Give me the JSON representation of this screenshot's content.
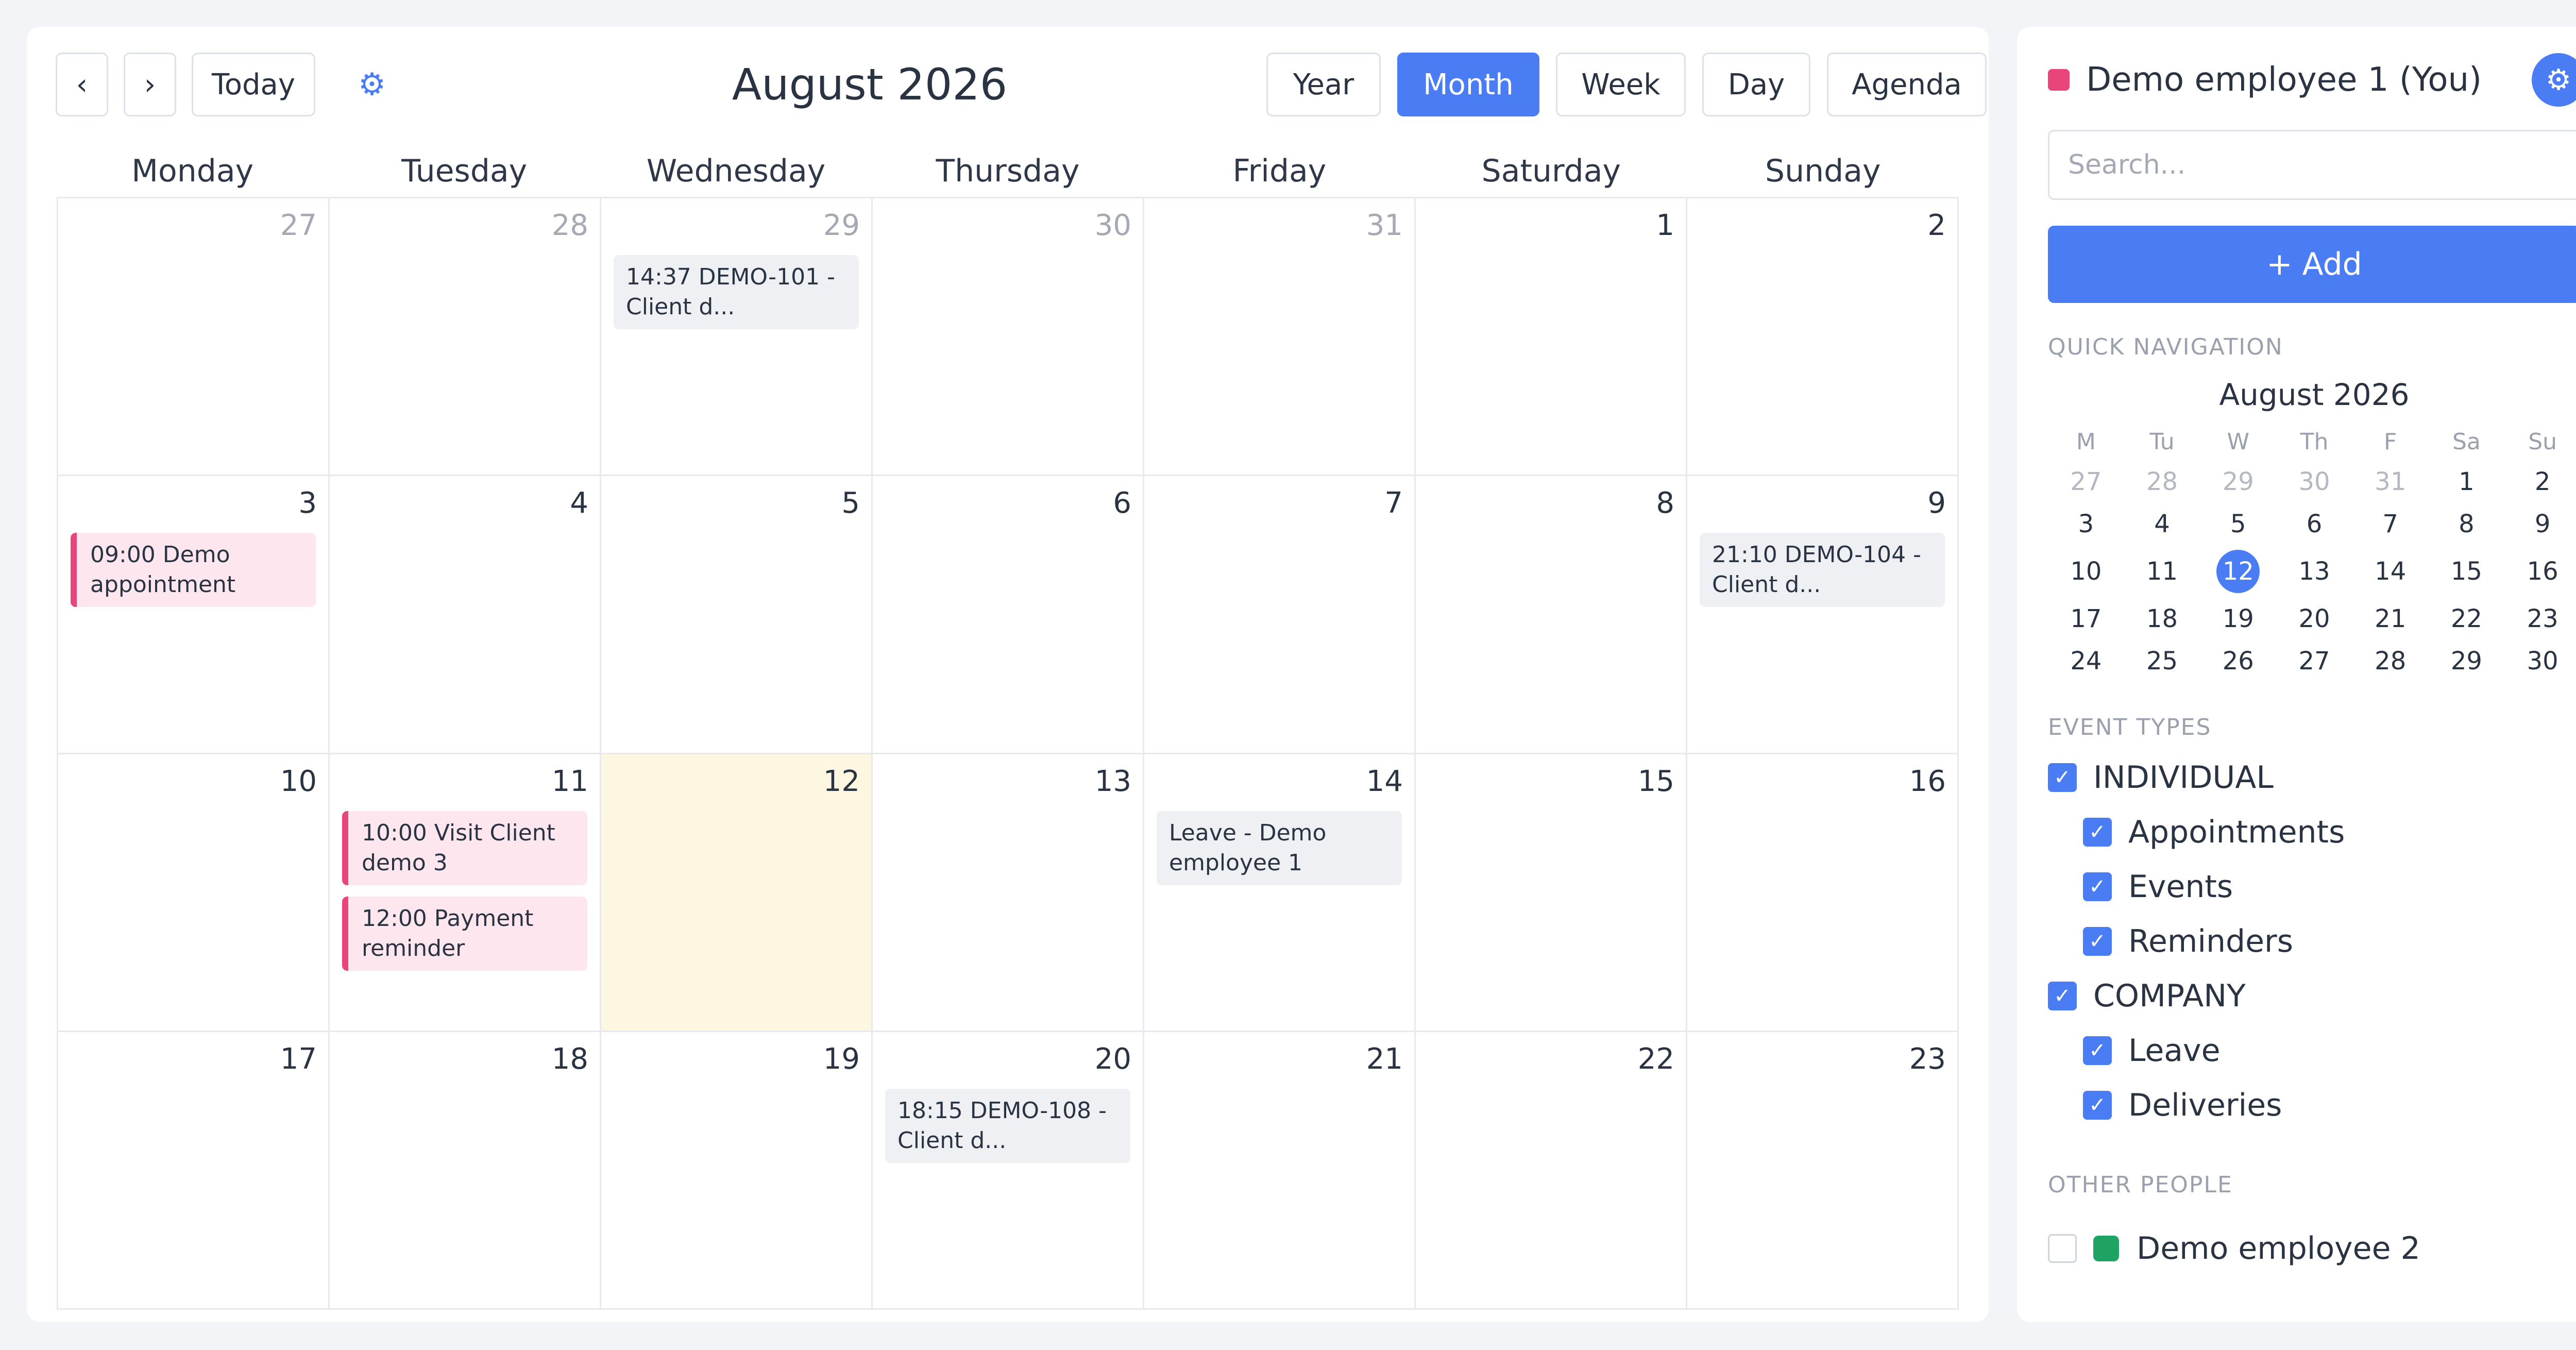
{
  "toolbar": {
    "prev_label": "‹",
    "next_label": "›",
    "today_label": "Today",
    "settings_icon": "gear-icon",
    "title": "August 2026",
    "views": [
      "Year",
      "Month",
      "Week",
      "Day",
      "Agenda"
    ],
    "active_view": "Month"
  },
  "weekdays": [
    "Monday",
    "Tuesday",
    "Wednesday",
    "Thursday",
    "Friday",
    "Saturday",
    "Sunday"
  ],
  "weeks": [
    [
      {
        "day": "27",
        "muted": true,
        "events": []
      },
      {
        "day": "28",
        "muted": true,
        "events": []
      },
      {
        "day": "29",
        "muted": true,
        "events": [
          {
            "text": "14:37 DEMO-101 - Client d...",
            "style": "gray"
          }
        ]
      },
      {
        "day": "30",
        "muted": true,
        "events": []
      },
      {
        "day": "31",
        "muted": true,
        "events": []
      },
      {
        "day": "1",
        "events": []
      },
      {
        "day": "2",
        "events": []
      }
    ],
    [
      {
        "day": "3",
        "events": [
          {
            "text": "09:00 Demo appointment",
            "style": "pink"
          }
        ]
      },
      {
        "day": "4",
        "events": []
      },
      {
        "day": "5",
        "events": []
      },
      {
        "day": "6",
        "events": []
      },
      {
        "day": "7",
        "events": []
      },
      {
        "day": "8",
        "events": []
      },
      {
        "day": "9",
        "events": [
          {
            "text": "21:10 DEMO-104 - Client d...",
            "style": "gray"
          }
        ]
      }
    ],
    [
      {
        "day": "10",
        "events": []
      },
      {
        "day": "11",
        "events": [
          {
            "text": "10:00 Visit Client demo 3",
            "style": "pink"
          },
          {
            "text": "12:00 Payment reminder",
            "style": "pink"
          }
        ]
      },
      {
        "day": "12",
        "today": true,
        "events": []
      },
      {
        "day": "13",
        "events": []
      },
      {
        "day": "14",
        "events": [
          {
            "text": "Leave - Demo employee 1",
            "style": "gray"
          }
        ]
      },
      {
        "day": "15",
        "events": []
      },
      {
        "day": "16",
        "events": []
      }
    ],
    [
      {
        "day": "17",
        "events": []
      },
      {
        "day": "18",
        "events": []
      },
      {
        "day": "19",
        "events": []
      },
      {
        "day": "20",
        "events": [
          {
            "text": "18:15 DEMO-108 - Client d...",
            "style": "gray"
          }
        ]
      },
      {
        "day": "21",
        "events": []
      },
      {
        "day": "22",
        "events": []
      },
      {
        "day": "23",
        "events": []
      }
    ]
  ],
  "sidebar": {
    "user_name": "Demo employee 1 (You)",
    "user_color": "#e8457a",
    "settings_icon": "gear-icon",
    "search_placeholder": "Search...",
    "add_label": "+ Add",
    "quick_nav_title": "QUICK NAVIGATION",
    "mini_calendar": {
      "title": "August 2026",
      "headers": [
        "M",
        "Tu",
        "W",
        "Th",
        "F",
        "Sa",
        "Su"
      ],
      "weeks": [
        [
          "27",
          "28",
          "29",
          "30",
          "31",
          "1",
          "2"
        ],
        [
          "3",
          "4",
          "5",
          "6",
          "7",
          "8",
          "9"
        ],
        [
          "10",
          "11",
          "12",
          "13",
          "14",
          "15",
          "16"
        ],
        [
          "17",
          "18",
          "19",
          "20",
          "21",
          "22",
          "23"
        ],
        [
          "24",
          "25",
          "26",
          "27",
          "28",
          "29",
          "30"
        ]
      ],
      "muted_first_week_count": 5,
      "selected": "12"
    },
    "event_types_title": "EVENT TYPES",
    "event_types": [
      {
        "label": "INDIVIDUAL",
        "checked": true,
        "level": 0
      },
      {
        "label": "Appointments",
        "checked": true,
        "level": 1
      },
      {
        "label": "Events",
        "checked": true,
        "level": 1
      },
      {
        "label": "Reminders",
        "checked": true,
        "level": 1
      },
      {
        "label": "COMPANY",
        "checked": true,
        "level": 0
      },
      {
        "label": "Leave",
        "checked": true,
        "level": 1
      },
      {
        "label": "Deliveries",
        "checked": true,
        "level": 1
      }
    ],
    "other_people_title": "OTHER PEOPLE",
    "other_people": [
      {
        "label": "Demo employee 2",
        "checked": false,
        "color": "#1fa365"
      }
    ],
    "check_glyph": "✓"
  },
  "colors": {
    "accent": "#4a7df4",
    "today_bg": "#fdf6e0",
    "event_pink": "#e8457a",
    "event_gray_bg": "#eff0f4"
  }
}
